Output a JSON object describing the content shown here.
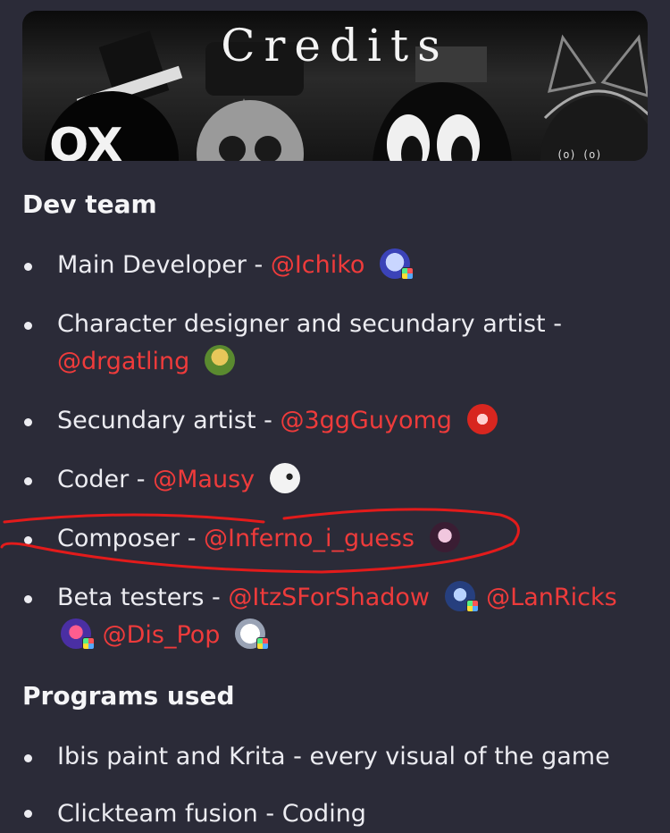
{
  "banner": {
    "title": "Credits"
  },
  "dev_team": {
    "heading": "Dev team",
    "items": [
      {
        "role": "Main Developer - ",
        "mention": "@Ichiko"
      },
      {
        "role": "Character designer and secundary artist - ",
        "mention": "@drgatling"
      },
      {
        "role": "Secundary artist - ",
        "mention": "@3ggGuyomg"
      },
      {
        "role": "Coder - ",
        "mention": "@Mausy"
      },
      {
        "role": "Composer - ",
        "mention": "@Inferno_i_guess"
      },
      {
        "role": "Beta testers - ",
        "mentions": [
          "@ItzSForShadow",
          "@LanRicks",
          "@Dis_Pop"
        ]
      }
    ]
  },
  "programs": {
    "heading": "Programs used",
    "items": [
      {
        "text": "Ibis paint and Krita - every visual of the game"
      },
      {
        "text": "Clickteam fusion - Coding"
      }
    ]
  },
  "colors": {
    "background": "#2b2b38",
    "mention": "#ee3b3b",
    "annotation": "#e31b1b"
  }
}
